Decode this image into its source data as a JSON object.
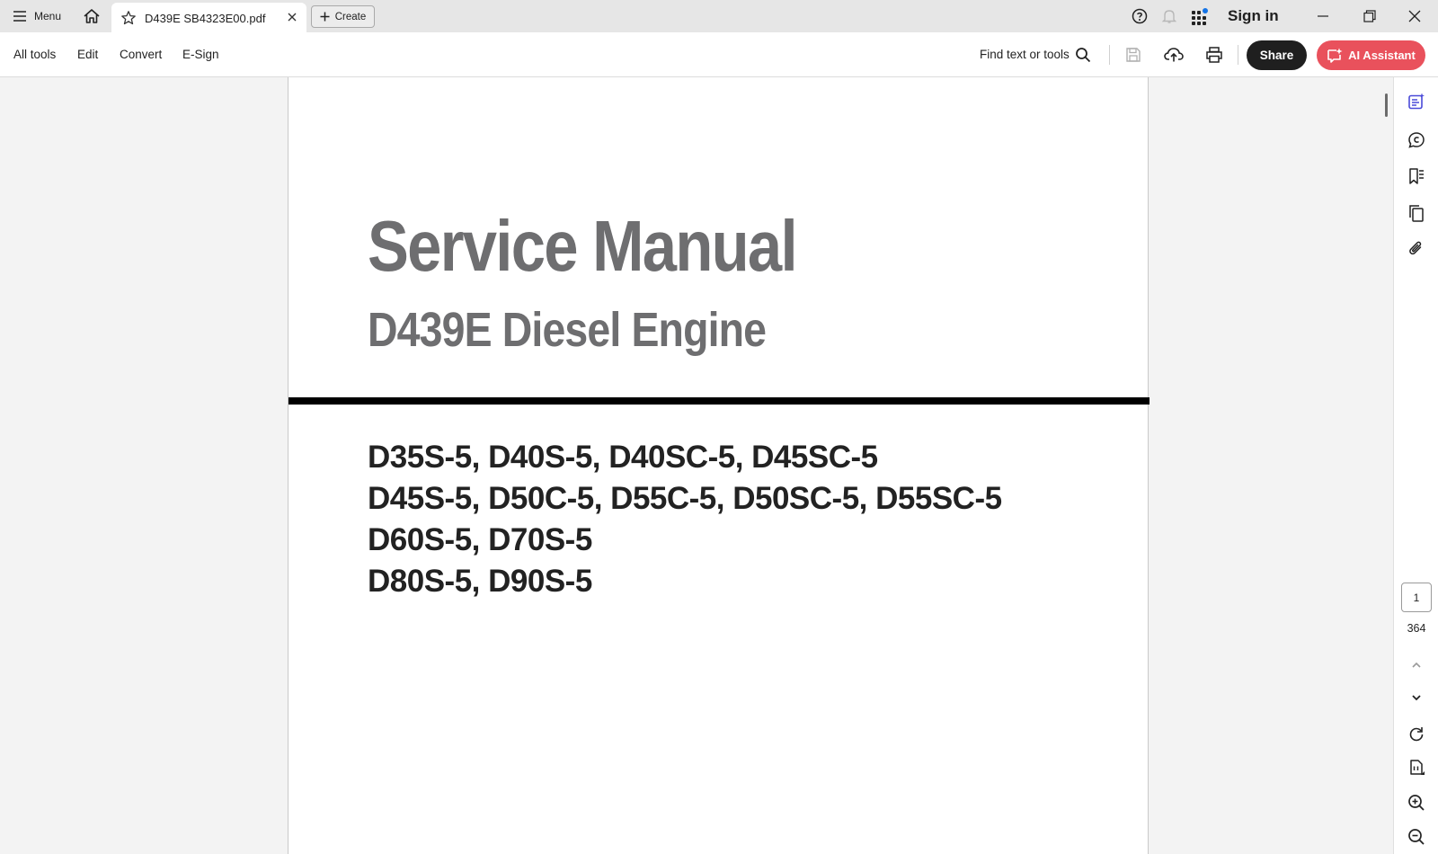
{
  "titlebar": {
    "menu_label": "Menu",
    "tab_title": "D439E SB4323E00.pdf",
    "create_label": "Create",
    "signin_label": "Sign in"
  },
  "toolbar": {
    "items": [
      "All tools",
      "Edit",
      "Convert",
      "E-Sign"
    ],
    "find_label": "Find text or tools",
    "share_label": "Share",
    "ai_label": "AI Assistant"
  },
  "document": {
    "title": "Service Manual",
    "subtitle": "D439E Diesel Engine",
    "models": [
      "D35S-5, D40S-5, D40SC-5, D45SC-5",
      "D45S-5, D50C-5, D55C-5, D50SC-5, D55SC-5",
      "D60S-5, D70S-5",
      "D80S-5, D90S-5"
    ]
  },
  "navigation": {
    "current_page": "1",
    "total_pages": "364"
  },
  "colors": {
    "accent": "#e9515c",
    "share": "#1f1f1f",
    "title_gray": "#6e6e70",
    "rail_active": "#4a4ad8",
    "notification_dot": "#1473e6"
  }
}
